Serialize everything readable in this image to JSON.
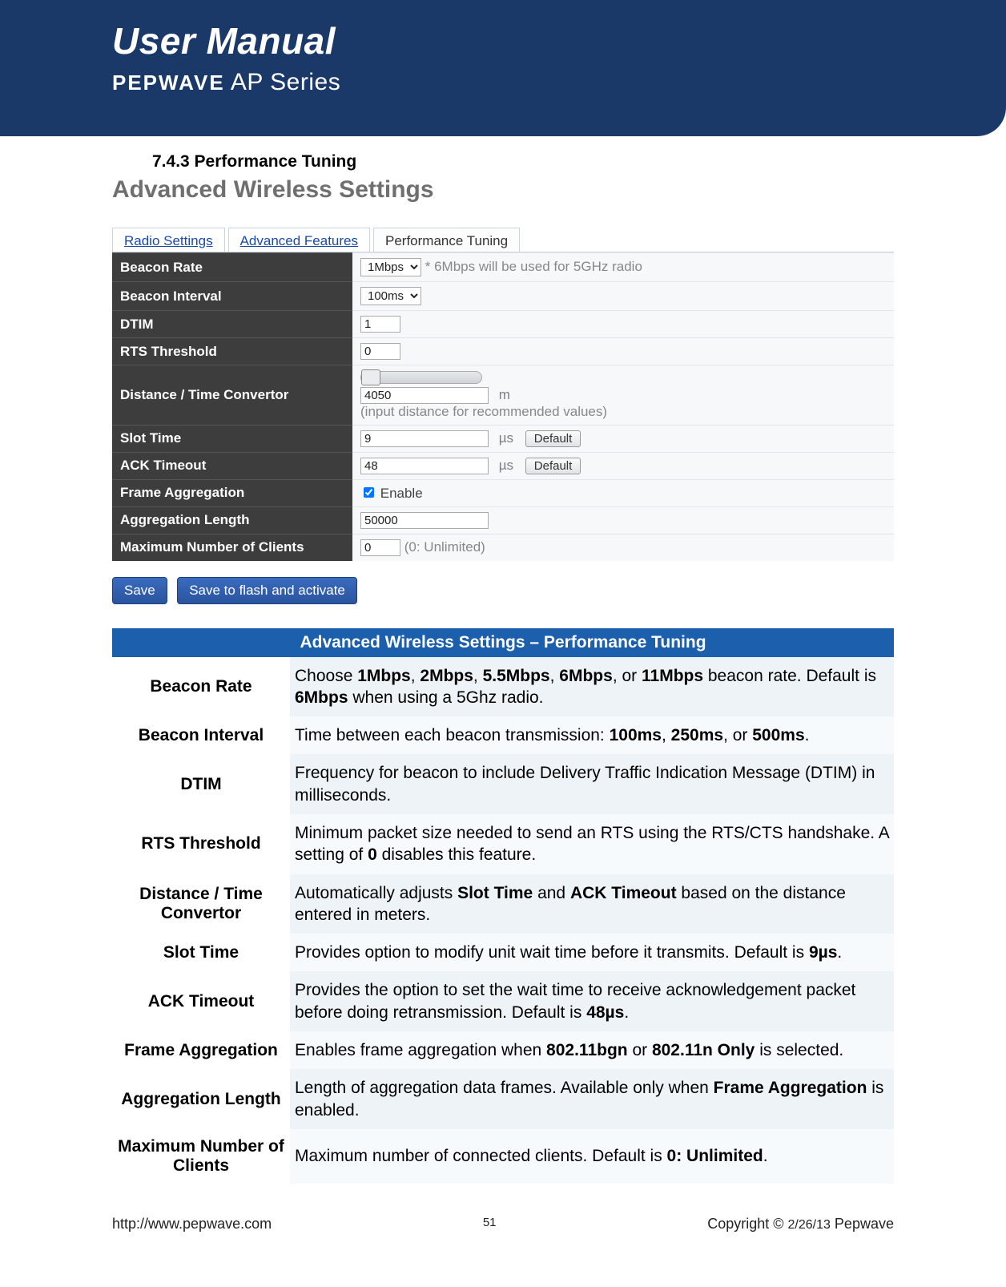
{
  "banner": {
    "title": "User Manual",
    "brand": "PEPWAVE",
    "series": " AP Series"
  },
  "section_number": "7.4.3 Performance Tuning",
  "advanced_title": "Advanced Wireless Settings",
  "tabs": {
    "radio": "Radio Settings",
    "advfeat": "Advanced Features",
    "perf": "Performance Tuning"
  },
  "settings": {
    "beacon_rate": {
      "label": "Beacon Rate",
      "value": "1Mbps",
      "note": "* 6Mbps will be used for 5GHz radio"
    },
    "beacon_interval": {
      "label": "Beacon Interval",
      "value": "100ms"
    },
    "dtim": {
      "label": "DTIM",
      "value": "1"
    },
    "rts": {
      "label": "RTS Threshold",
      "value": "0"
    },
    "distance": {
      "label": "Distance / Time Convertor",
      "value": "4050",
      "unit": "m",
      "hint": "(input distance for recommended values)"
    },
    "slot_time": {
      "label": "Slot Time",
      "value": "9",
      "unit": "µs",
      "btn": "Default"
    },
    "ack_timeout": {
      "label": "ACK Timeout",
      "value": "48",
      "unit": "µs",
      "btn": "Default"
    },
    "frame_agg": {
      "label": "Frame Aggregation",
      "enable_label": "Enable"
    },
    "agg_length": {
      "label": "Aggregation Length",
      "value": "50000"
    },
    "max_clients": {
      "label": "Maximum Number of Clients",
      "value": "0",
      "hint": "(0: Unlimited)"
    }
  },
  "buttons": {
    "save": "Save",
    "save_activate": "Save to flash and activate"
  },
  "desc_header": "Advanced Wireless Settings – Performance Tuning",
  "desc": {
    "beacon_rate": {
      "label": "Beacon Rate",
      "t1": "Choose ",
      "b1": "1Mbps",
      "c1": ", ",
      "b2": "2Mbps",
      "c2": ", ",
      "b3": "5.5Mbps",
      "c3": ", ",
      "b4": "6Mbps",
      "c4": ", or ",
      "b5": "11Mbps",
      "t2": " beacon rate. Default is ",
      "b6": "6Mbps",
      "t3": " when using a 5Ghz radio."
    },
    "beacon_interval": {
      "label": "Beacon Interval",
      "t1": "Time between each beacon transmission: ",
      "b1": "100ms",
      "c1": ", ",
      "b2": "250ms",
      "c2": ", or ",
      "b3": "500ms",
      "t2": "."
    },
    "dtim": {
      "label": "DTIM",
      "t1": "Frequency for beacon to include Delivery Traffic Indication Message (DTIM) in milliseconds."
    },
    "rts": {
      "label": "RTS Threshold",
      "t1": "Minimum packet size needed to send an RTS using the RTS/CTS handshake. A setting of ",
      "b1": "0",
      "t2": " disables this feature."
    },
    "distance": {
      "label": "Distance / Time Convertor",
      "t1": "Automatically adjusts ",
      "b1": "Slot Time",
      "t2": " and ",
      "b2": "ACK Timeout",
      "t3": " based on the distance entered in meters."
    },
    "slot_time": {
      "label": "Slot Time",
      "t1": "Provides option to modify unit wait time before it transmits. Default is ",
      "b1": "9µs",
      "t2": "."
    },
    "ack_timeout": {
      "label": "ACK Timeout",
      "t1": "Provides the option to set the wait time to receive acknowledgement packet before doing retransmission. Default is ",
      "b1": "48µs",
      "t2": "."
    },
    "frame_agg": {
      "label": "Frame Aggregation",
      "t1": "Enables frame aggregation when ",
      "b1": "802.11bgn",
      "t2": " or ",
      "b2": "802.11n Only",
      "t3": " is selected."
    },
    "agg_length": {
      "label": "Aggregation Length",
      "t1": "Length of aggregation data frames. Available only when ",
      "b1": "Frame Aggregation",
      "t2": " is enabled."
    },
    "max_clients": {
      "label": "Maximum Number of Clients",
      "t1": "Maximum number of connected clients. Default is ",
      "b1": "0: Unlimited",
      "t2": "."
    }
  },
  "footer": {
    "url": "http://www.pepwave.com",
    "page": "51",
    "copyright_prefix": "Copyright © ",
    "date": "2/26/13",
    "brand": " Pepwave"
  }
}
